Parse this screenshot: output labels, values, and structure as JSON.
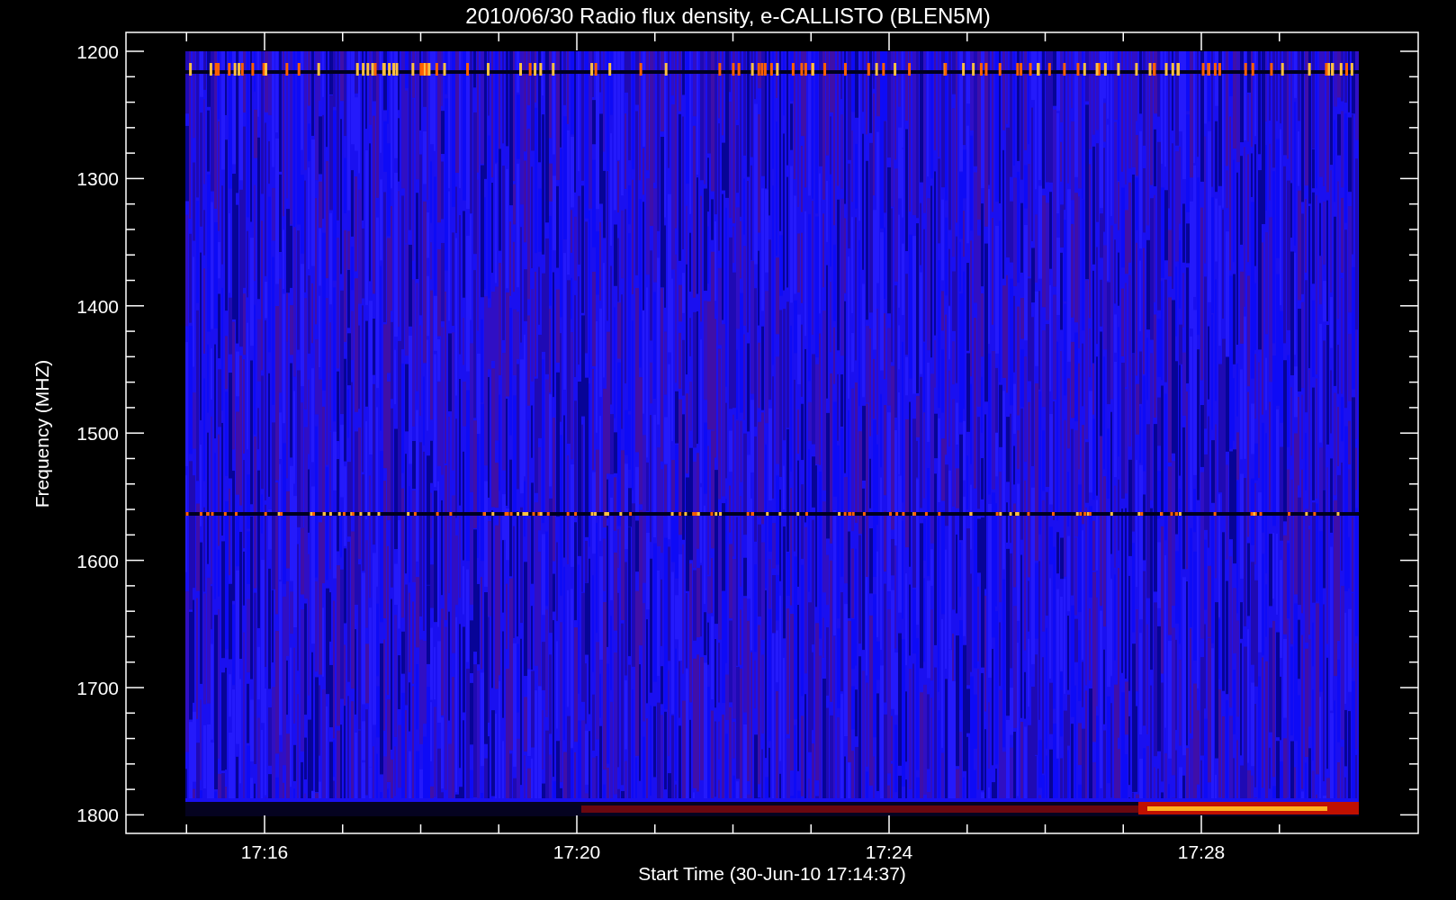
{
  "title": "2010/06/30  Radio flux density, e-CALLISTO (BLEN5M)",
  "y_axis": {
    "label": "Frequency (MHZ)",
    "ticks": [
      "1200",
      "1300",
      "1400",
      "1500",
      "1600",
      "1700",
      "1800"
    ]
  },
  "x_axis": {
    "label": "Start Time (30-Jun-10 17:14:37)",
    "ticks": [
      "17:16",
      "17:20",
      "17:24",
      "17:28"
    ]
  }
}
